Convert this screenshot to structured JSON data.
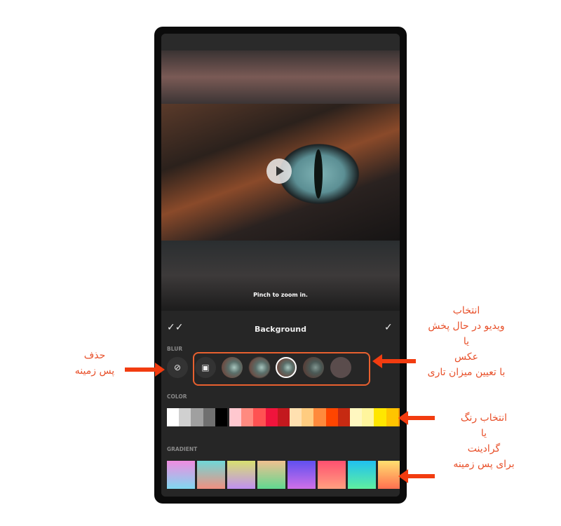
{
  "viewer": {
    "hint": "Pinch to zoom in.",
    "play_icon": "play-icon"
  },
  "panel": {
    "title": "Background",
    "apply_all_icon": "double-check-icon",
    "done_icon": "check-icon",
    "blur_label": "BLUR",
    "color_label": "COLOR",
    "gradient_label": "GRADIENT",
    "blur_options": [
      "none",
      "image",
      "blur-1",
      "blur-2",
      "blur-3",
      "blur-4",
      "blur-5"
    ],
    "selected_blur": 3,
    "colors": [
      "#ffffff",
      "#d0d0d0",
      "#a0a0a0",
      "#707070",
      "#000000",
      "#ffc8cf",
      "#ff8a80",
      "#ff5252",
      "#f0143c",
      "#c3191e",
      "#ffe0b0",
      "#ffcc80",
      "#ff8a3c",
      "#ff4500",
      "#c62a12",
      "#fff7c0",
      "#fff59d",
      "#ffe600",
      "#ffc400",
      "#ff9800"
    ],
    "gradients": [
      [
        "#f08ce0",
        "#80d8f0"
      ],
      [
        "#70d8d8",
        "#f09080"
      ],
      [
        "#d8e070",
        "#c090f0"
      ],
      [
        "#f0c090",
        "#60d890"
      ],
      [
        "#6050f0",
        "#d070e8"
      ],
      [
        "#ff5070",
        "#ffa080"
      ],
      [
        "#20c0f0",
        "#60f0a0"
      ],
      [
        "#ffe070",
        "#ff7050"
      ]
    ]
  },
  "annotations": {
    "remove": [
      "حذف",
      "پس زمینه"
    ],
    "blur": [
      "انتخاب",
      "ویدیو در حال پخش",
      "یا",
      "عکس",
      "با تعیین میزان تاری"
    ],
    "color": [
      "انتخاب رنگ",
      "یا",
      "گرادینت",
      "برای پس زمینه"
    ]
  },
  "colors": {
    "accent": "#e8502a",
    "arrow": "#f23c10",
    "panel": "#262626"
  }
}
